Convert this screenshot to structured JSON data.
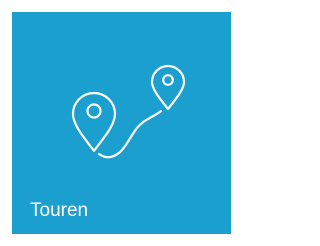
{
  "tile": {
    "label": "Touren",
    "icon": "route-map-pins-icon",
    "background_color": "#1a9fcf",
    "foreground_color": "#ffffff"
  }
}
